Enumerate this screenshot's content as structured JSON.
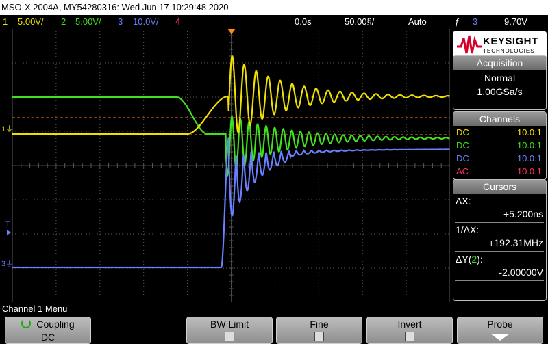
{
  "title_bar": {
    "text": "MSO-X 2004A, MY54280316: Wed Jun 17 10:29:48 2020"
  },
  "status": {
    "ch1": {
      "num": "1",
      "scale": "5.00V/",
      "color": "#f0e000"
    },
    "ch2": {
      "num": "2",
      "scale": "5.00V/",
      "color": "#40e020"
    },
    "ch3": {
      "num": "3",
      "scale": "10.0V/",
      "color": "#6a80ff"
    },
    "ch4": {
      "num": "4",
      "color": "#ff3060"
    },
    "time_delay": "0.0s",
    "time_scale": "50.00§/",
    "trigger_mode": "Auto",
    "trigger_symbol": "ƒ",
    "trigger_channel": "3",
    "trigger_level": "9.70V"
  },
  "markers": {
    "ch1": "1",
    "ch3": "3",
    "trigger": "T"
  },
  "brand": {
    "name": "KEYSIGHT",
    "sub": "TECHNOLOGIES",
    "color": "#d4002a"
  },
  "acquisition": {
    "header": "Acquisition",
    "mode": "Normal",
    "rate": "1.00GSa/s"
  },
  "channels": {
    "header": "Channels",
    "rows": [
      {
        "coupling": "DC",
        "ratio": "10.0:1",
        "color": "#f0e000"
      },
      {
        "coupling": "DC",
        "ratio": "10.0:1",
        "color": "#40e020"
      },
      {
        "coupling": "DC",
        "ratio": "10.0:1",
        "color": "#6a80ff"
      },
      {
        "coupling": "AC",
        "ratio": "10.0:1",
        "color": "#ff3060"
      }
    ]
  },
  "cursors": {
    "header": "Cursors",
    "dx_label": "ΔX:",
    "dx_value": "+5.200ns",
    "inv_label": "1/ΔX:",
    "inv_value": "+192.31MHz",
    "dy_label": "ΔY(",
    "dy_ch": "2",
    "dy_close": "):",
    "dy_value": "-2.00000V"
  },
  "menu_title": "Channel 1 Menu",
  "softkeys": {
    "coupling": {
      "label": "Coupling",
      "value": "DC"
    },
    "bw_limit": {
      "label": "BW Limit"
    },
    "fine": {
      "label": "Fine"
    },
    "invert": {
      "label": "Invert"
    },
    "probe": {
      "label": "Probe"
    }
  },
  "colors": {
    "ch1": "#f0e000",
    "ch2": "#40e020",
    "ch3": "#6a80ff",
    "cursor": "#ff7a1a",
    "grid": "#555555"
  }
}
